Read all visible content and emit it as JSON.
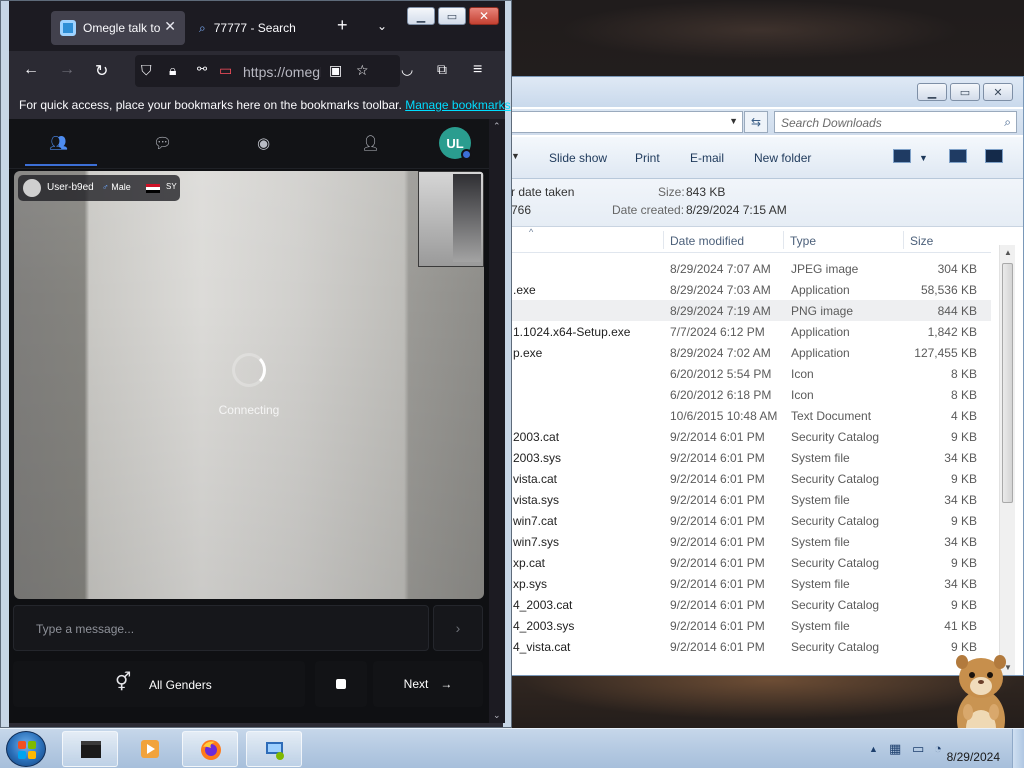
{
  "firefox": {
    "tabs": [
      {
        "title": "Omegle talk to strangers"
      },
      {
        "title": "77777 - Search"
      }
    ],
    "url": "https://omegle",
    "bookmarks_message": "For quick access, place your bookmarks here on the bookmarks toolbar.",
    "bookmarks_link": "Manage bookmarks"
  },
  "omegle": {
    "avatar_initials": "UL",
    "stranger": {
      "name": "User-b9ed",
      "gender": "Male",
      "country": "SY"
    },
    "status": "Connecting",
    "message_placeholder": "Type a message...",
    "gender_filter": "All Genders",
    "next_label": "Next"
  },
  "explorer": {
    "search_placeholder": "Search Downloads",
    "toolbar": [
      "Slide show",
      "Print",
      "E-mail",
      "New folder"
    ],
    "details": {
      "date_taken_label": "r date taken",
      "dimensions_fragment": "766",
      "size_label": "Size:",
      "size_value": "843 KB",
      "created_label": "Date created:",
      "created_value": "8/29/2024 7:15 AM"
    },
    "columns": [
      "Date modified",
      "Type",
      "Size"
    ],
    "rows": [
      {
        "name": "",
        "date": "8/29/2024 7:07 AM",
        "type": "JPEG image",
        "size": "304 KB"
      },
      {
        "name": ".exe",
        "date": "8/29/2024 7:03 AM",
        "type": "Application",
        "size": "58,536 KB"
      },
      {
        "name": "",
        "date": "8/29/2024 7:19 AM",
        "type": "PNG image",
        "size": "844 KB"
      },
      {
        "name": "1.1024.x64-Setup.exe",
        "date": "7/7/2024 6:12 PM",
        "type": "Application",
        "size": "1,842 KB"
      },
      {
        "name": "p.exe",
        "date": "8/29/2024 7:02 AM",
        "type": "Application",
        "size": "127,455 KB"
      },
      {
        "name": "",
        "date": "6/20/2012 5:54 PM",
        "type": "Icon",
        "size": "8 KB"
      },
      {
        "name": "",
        "date": "6/20/2012 6:18 PM",
        "type": "Icon",
        "size": "8 KB"
      },
      {
        "name": "",
        "date": "10/6/2015 10:48 AM",
        "type": "Text Document",
        "size": "4 KB"
      },
      {
        "name": "2003.cat",
        "date": "9/2/2014 6:01 PM",
        "type": "Security Catalog",
        "size": "9 KB"
      },
      {
        "name": "2003.sys",
        "date": "9/2/2014 6:01 PM",
        "type": "System file",
        "size": "34 KB"
      },
      {
        "name": "vista.cat",
        "date": "9/2/2014 6:01 PM",
        "type": "Security Catalog",
        "size": "9 KB"
      },
      {
        "name": "vista.sys",
        "date": "9/2/2014 6:01 PM",
        "type": "System file",
        "size": "34 KB"
      },
      {
        "name": "win7.cat",
        "date": "9/2/2014 6:01 PM",
        "type": "Security Catalog",
        "size": "9 KB"
      },
      {
        "name": "win7.sys",
        "date": "9/2/2014 6:01 PM",
        "type": "System file",
        "size": "34 KB"
      },
      {
        "name": "xp.cat",
        "date": "9/2/2014 6:01 PM",
        "type": "Security Catalog",
        "size": "9 KB"
      },
      {
        "name": "xp.sys",
        "date": "9/2/2014 6:01 PM",
        "type": "System file",
        "size": "34 KB"
      },
      {
        "name": "4_2003.cat",
        "date": "9/2/2014 6:01 PM",
        "type": "Security Catalog",
        "size": "9 KB"
      },
      {
        "name": "4_2003.sys",
        "date": "9/2/2014 6:01 PM",
        "type": "System file",
        "size": "41 KB"
      },
      {
        "name": "4_vista.cat",
        "date": "9/2/2014 6:01 PM",
        "type": "Security Catalog",
        "size": "9 KB"
      }
    ]
  },
  "taskbar": {
    "date": "8/29/2024"
  },
  "colors": {
    "firefox_chrome": "#1c1b22",
    "omegle_accent": "#3c6fd6",
    "link": "#00ddff"
  }
}
